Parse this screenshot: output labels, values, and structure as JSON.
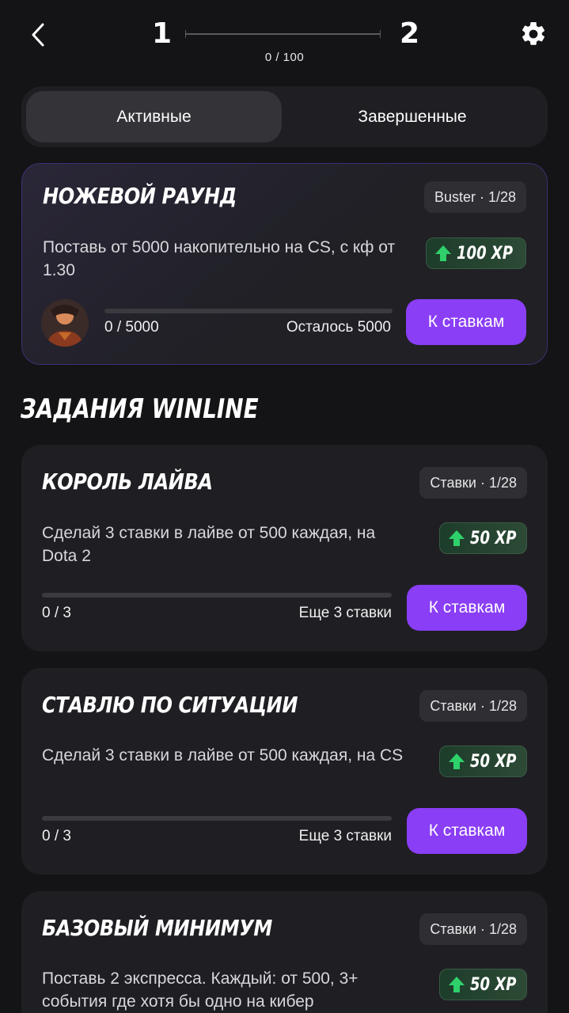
{
  "header": {
    "current_level": "1",
    "next_level": "2",
    "progress_text": "0 / 100",
    "progress_fraction": 0
  },
  "tabs": [
    {
      "label": "Активные",
      "active": true
    },
    {
      "label": "Завершенные",
      "active": false
    }
  ],
  "featured_task": {
    "title": "НОЖЕВОЙ РАУНД",
    "badge": "Buster · 1/28",
    "description": "Поставь от 5000 накопительно на CS, с кф от 1.30",
    "xp": "100 XP",
    "progress_text": "0 / 5000",
    "remaining_text": "Осталось 5000",
    "progress_fraction": 0,
    "button_label": "К ставкам"
  },
  "section_title": "ЗАДАНИЯ WINLINE",
  "tasks": [
    {
      "title": "КОРОЛЬ ЛАЙВА",
      "badge": "Ставки · 1/28",
      "description": "Сделай 3 ставки в лайве от 500 каждая, на Dota 2",
      "xp": "50 XP",
      "progress_text": "0 / 3",
      "remaining_text": "Еще 3 ставки",
      "progress_fraction": 0,
      "button_label": "К ставкам"
    },
    {
      "title": "СТАВЛЮ ПО СИТУАЦИИ",
      "badge": "Ставки · 1/28",
      "description": "Сделай 3 ставки в лайве от 500 каждая, на CS",
      "xp": "50 XP",
      "progress_text": "0 / 3",
      "remaining_text": "Еще 3 ставки",
      "progress_fraction": 0,
      "button_label": "К ставкам"
    },
    {
      "title": "БАЗОВЫЙ МИНИМУМ",
      "badge": "Ставки · 1/28",
      "description": "Поставь 2 экспресса. Каждый: от 500, 3+ события где хотя бы одно на кибер",
      "xp": "50 XP"
    }
  ],
  "colors": {
    "accent": "#8a3ef5",
    "background": "#141416",
    "card": "#1f1f23",
    "xp_green": "#2fd16a"
  }
}
